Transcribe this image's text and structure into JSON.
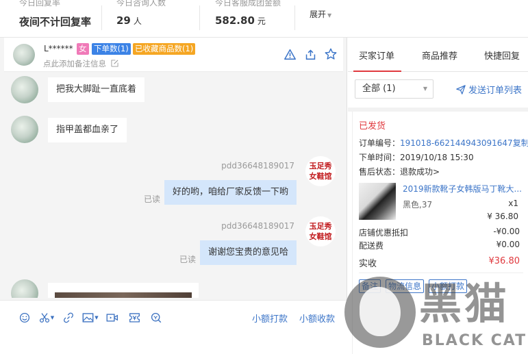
{
  "stats": {
    "items": [
      {
        "label": "今日回复率",
        "value": "夜间不计回复率",
        "unit": ""
      },
      {
        "label": "今日咨询人数",
        "value": "29",
        "unit": "人"
      },
      {
        "label": "今日客服成团金额",
        "value": "582.80",
        "unit": "元"
      }
    ],
    "expand_label": "展开"
  },
  "chat_header": {
    "name": "L******",
    "gender_badge": "女",
    "orders_badge": "下单数(1)",
    "fav_badge": "已收藏商品数(1)",
    "note_placeholder": "点此添加备注信息"
  },
  "messages": {
    "incoming": [
      "把我大脚趾一直底着",
      "指甲盖都血亲了"
    ],
    "outgoing": [
      {
        "sender": "pdd36648189017",
        "text": "好的哟，咱给厂家反馈一下哟",
        "status": "已读"
      },
      {
        "sender": "pdd36648189017",
        "text": "谢谢您宝贵的意见哈",
        "status": "已读"
      }
    ],
    "shop_logo_text": "玉足秀女鞋馆"
  },
  "toolbar": {
    "small_pay": "小额打款",
    "small_collect": "小额收款"
  },
  "right_panel": {
    "tabs": [
      "买家订单",
      "商品推荐",
      "快捷回复"
    ],
    "filter_value": "全部 (1)",
    "send_list": "发送订单列表",
    "order": {
      "status": "已发货",
      "order_no_label": "订单编号：",
      "order_no": "191018-662144943091647",
      "copy": "复制",
      "time_label": "下单时间：",
      "time": "2019/10/18 15:30",
      "after_sale_label": "售后状态：",
      "after_sale": "退款成功>",
      "product_title": "2019新款靴子女韩版马丁靴大...",
      "product_spec": "黑色,37",
      "product_qty": "x1",
      "product_price": "¥ 36.80",
      "discount_label": "店铺优惠抵扣",
      "discount_value": "-¥0.00",
      "shipping_label": "配送费",
      "shipping_value": "¥0.00",
      "paid_label": "实收",
      "paid_value": "¥36.80",
      "buttons": [
        "备注",
        "物流信息",
        "小额打款"
      ]
    }
  },
  "watermark": {
    "cn": "黑猫",
    "en": "BLACK CAT"
  },
  "colors": {
    "accent_red": "#e0393e",
    "link_blue": "#3c75c8",
    "bubble_out": "#d4e6fb",
    "badge_pink": "#f07ab8",
    "badge_blue": "#3c83e6",
    "badge_orange": "#f5a623"
  }
}
